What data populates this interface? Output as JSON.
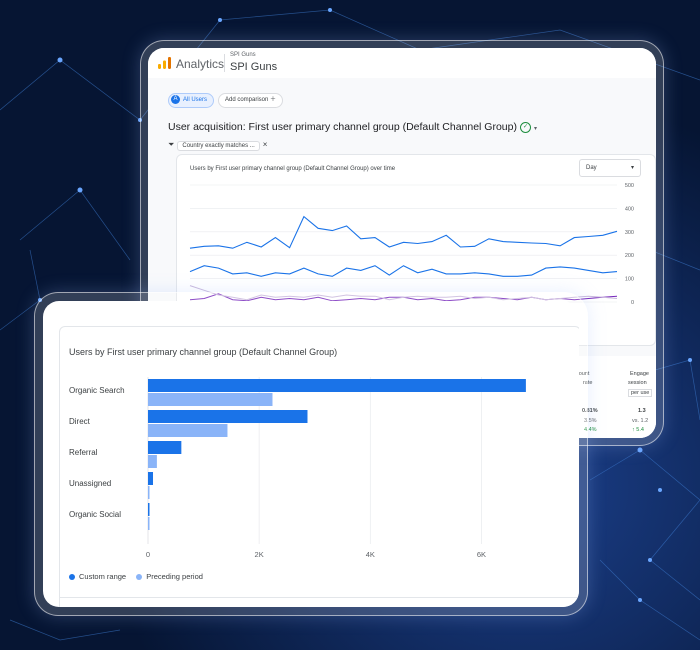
{
  "colors": {
    "primary_blue": "#1a73e8",
    "light_blue": "#8ab4f8",
    "purple": "#7627bb",
    "gray_line": "#c9b8dc",
    "ga_orange": "#f9ab00",
    "ga_dark_orange": "#e37400",
    "bg_navy": "#061533"
  },
  "header": {
    "app_name": "Analytics",
    "account_name": "SPI Guns",
    "property_name": "SPI Guns",
    "logo_icon": "analytics-bars-icon"
  },
  "comparisons": {
    "all_users_badge": "A",
    "all_users": "All Users",
    "add_comparison": "Add comparison",
    "add_icon": "plus-icon"
  },
  "report": {
    "title": "User acquisition: First user primary channel group (Default Channel Group)",
    "status_icon": "check-circle-icon",
    "filter_label": "Country exactly matches ...",
    "filter_icon": "filter-icon",
    "close_icon": "close-icon"
  },
  "line_card": {
    "title": "Users by First user primary channel group (Default Channel Group) over time",
    "granularity": "Day",
    "dropdown_icon": "caret-down-icon"
  },
  "table_fragment": {
    "header_cells": [
      "count",
      "rate",
      "Engage",
      "session",
      "per use"
    ],
    "values": [
      "0.81%",
      "1.3",
      "3.5%",
      "vs. 1.2",
      "4.4%",
      "↑ 5.4"
    ]
  },
  "bar_card": {
    "title": "Users by First user primary channel group (Default Channel Group)",
    "legend": {
      "current": "Custom range",
      "previous": "Preceding period"
    }
  },
  "chart_data": [
    {
      "type": "line",
      "title": "Users by First user primary channel group (Default Channel Group) over time",
      "ylim": [
        0,
        500
      ],
      "y_ticks": [
        "500",
        "400",
        "300",
        "200",
        "100",
        "0"
      ],
      "grid": true,
      "series": [
        {
          "values": [
            230,
            238,
            240,
            230,
            255,
            235,
            275,
            232,
            365,
            315,
            305,
            325,
            270,
            275,
            235,
            255,
            250,
            258,
            285,
            235,
            238,
            270,
            258,
            255,
            252,
            250,
            240,
            275,
            280,
            285,
            302
          ]
        },
        {
          "values": [
            130,
            155,
            145,
            120,
            125,
            110,
            125,
            120,
            145,
            120,
            110,
            145,
            135,
            155,
            115,
            155,
            125,
            140,
            120,
            120,
            125,
            120,
            110,
            110,
            115,
            145,
            150,
            145,
            135,
            125,
            130
          ]
        },
        {
          "values": [
            10,
            15,
            35,
            10,
            5,
            20,
            10,
            15,
            10,
            20,
            5,
            10,
            15,
            10,
            20,
            20,
            10,
            15,
            5,
            10,
            20,
            20,
            15,
            10,
            20,
            10,
            15,
            10,
            15,
            20,
            25
          ]
        },
        {
          "values": [
            70,
            50,
            30,
            20,
            10,
            30,
            20,
            25,
            20,
            30,
            20,
            30,
            25,
            25,
            10,
            20,
            25,
            20,
            20,
            25,
            15,
            20,
            10,
            15,
            20,
            10,
            15,
            20,
            25,
            20,
            15
          ]
        }
      ]
    },
    {
      "type": "bar",
      "orientation": "horizontal",
      "title": "Users by First user primary channel group (Default Channel Group)",
      "categories": [
        "Organic Search",
        "Direct",
        "Referral",
        "Unassigned",
        "Organic Social"
      ],
      "x_ticks": [
        "0",
        "2K",
        "4K",
        "6K"
      ],
      "xlim": [
        0,
        7000
      ],
      "legend_position": "bottom-left",
      "series": [
        {
          "name": "Custom range",
          "values": [
            6800,
            2870,
            600,
            90,
            20
          ]
        },
        {
          "name": "Preceding period",
          "values": [
            2240,
            1430,
            160,
            20,
            10
          ]
        }
      ]
    }
  ]
}
